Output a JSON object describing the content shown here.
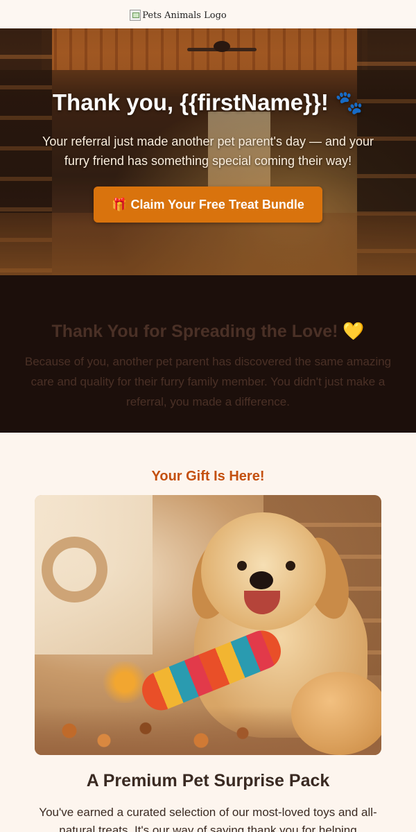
{
  "header": {
    "logo_alt": "Pets Animals Logo"
  },
  "hero": {
    "title": "Thank you, {{firstName}}! 🐾",
    "subtitle": "Your referral just made another pet parent's day — and your furry friend has something special coming their way!",
    "cta_label": "🎁 Claim Your Free Treat Bundle",
    "cta_color": "#d9730d"
  },
  "love": {
    "title": "Thank You for Spreading the Love! 💛",
    "text": "Because of you, another pet parent has discovered the same amazing care and quality for their furry family member. You didn't just make a referral, you made a difference."
  },
  "gift": {
    "heading": "Your Gift Is Here!",
    "title": "A Premium Pet Surprise Pack",
    "text": "You've earned a curated selection of our most-loved toys and all-natural treats. It's our way of saying thank you for helping another"
  },
  "colors": {
    "accent": "#c4500f",
    "dark_section": "#1c0f0b",
    "page_bg": "#fdf5ee"
  }
}
